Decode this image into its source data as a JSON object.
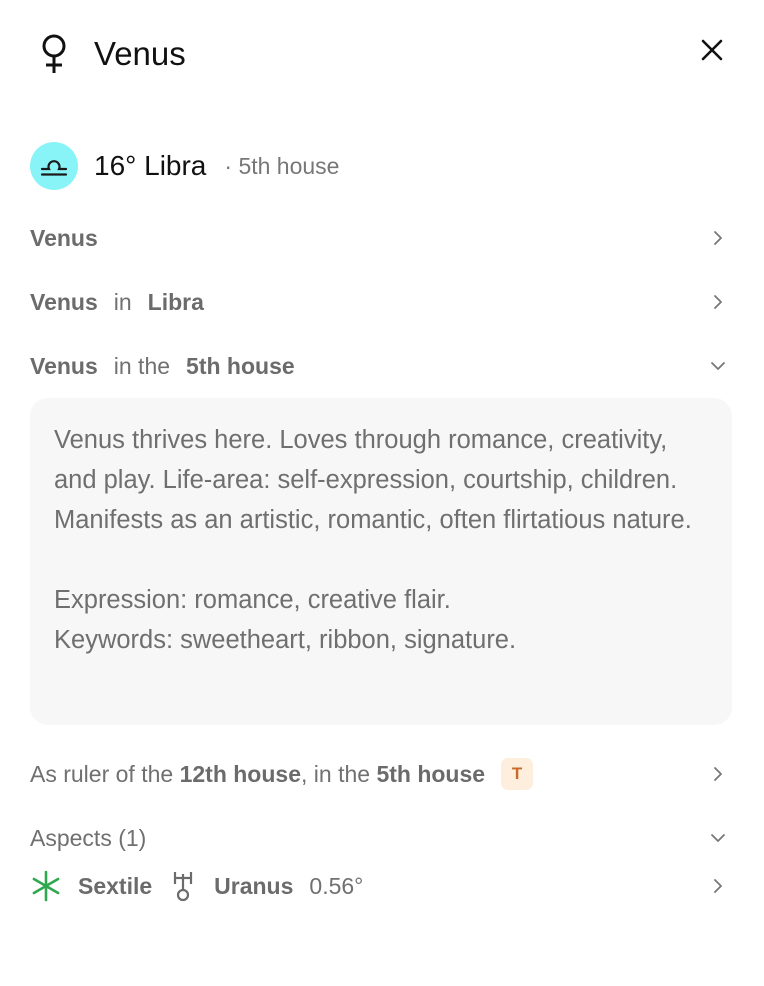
{
  "header": {
    "title": "Venus",
    "planet_icon": "venus-glyph-icon",
    "close_icon": "close-icon"
  },
  "placement": {
    "sign_icon": "libra-glyph-icon",
    "sign_color": "#88f4f8",
    "position": "16° Libra",
    "house": "· 5th house"
  },
  "rows": {
    "planet": {
      "label": "Venus"
    },
    "sign": {
      "planet": "Venus",
      "connector": "in",
      "sign": "Libra"
    },
    "house": {
      "planet": "Venus",
      "connector": "in the",
      "house": "5th house"
    }
  },
  "description": {
    "paragraph": "Venus thrives here. Loves through romance, creativity, and play. Life-area: self-expression, courtship, children. Manifests as an artistic, romantic, often flirtatious nature.",
    "expression": "Expression: romance, creative flair.",
    "keywords": "Keywords: sweetheart, ribbon, signature."
  },
  "ruler": {
    "prefix": "As ruler of the",
    "ruled_house": "12th house",
    "middle": ", in the",
    "house": "5th house",
    "badge": "T",
    "badge_color": "#c86a2a"
  },
  "aspects": {
    "label": "Aspects (1)",
    "items": [
      {
        "aspect_icon": "sextile-icon",
        "aspect_color": "#2fa84f",
        "aspect": "Sextile",
        "planet_icon": "uranus-glyph-icon",
        "planet": "Uranus",
        "orb": "0.56°"
      }
    ]
  }
}
